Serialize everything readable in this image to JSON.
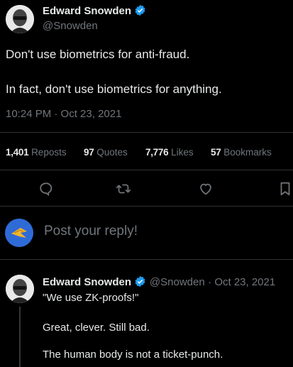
{
  "tweet": {
    "author_name": "Edward Snowden",
    "author_handle": "@Snowden",
    "line1": "Don't use biometrics for anti-fraud.",
    "line2": "In fact, don't use biometrics for anything.",
    "timestamp": "10:24 PM · Oct 23, 2021",
    "stats": {
      "reposts_count": "1,401",
      "reposts_label": "Reposts",
      "quotes_count": "97",
      "quotes_label": "Quotes",
      "likes_count": "7,776",
      "likes_label": "Likes",
      "bookmarks_count": "57",
      "bookmarks_label": "Bookmarks"
    },
    "actions": [
      "reply-icon",
      "repost-icon",
      "like-icon",
      "bookmark-icon"
    ]
  },
  "composer": {
    "placeholder": "Post your reply!"
  },
  "reply": {
    "author_name": "Edward Snowden",
    "author_handle": "@Snowden",
    "date": "· Oct 23, 2021",
    "line1": "\"We use ZK-proofs!\"",
    "line2": "Great, clever. Still bad.",
    "line3": "The human body is not a ticket-punch."
  },
  "colors": {
    "background": "#000000",
    "text": "#e7e9ea",
    "muted": "#71767b",
    "divider": "#2f3336",
    "verified": "#1d9bf0"
  }
}
